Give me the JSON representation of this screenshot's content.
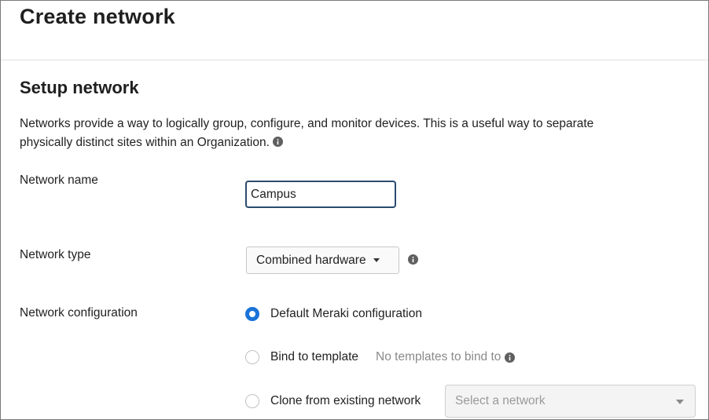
{
  "page": {
    "title": "Create network"
  },
  "setup": {
    "heading": "Setup network",
    "description": "Networks provide a way to logically group, configure, and monitor devices. This is a useful way to separate physically distinct sites within an Organization."
  },
  "fields": {
    "name": {
      "label": "Network name",
      "value": "Campus"
    },
    "type": {
      "label": "Network type",
      "selected": "Combined hardware"
    },
    "configuration": {
      "label": "Network configuration",
      "options": [
        {
          "label": "Default Meraki configuration",
          "checked": true
        },
        {
          "label": "Bind to template",
          "checked": false,
          "hint": "No templates to bind to"
        },
        {
          "label": "Clone from existing network",
          "checked": false
        }
      ],
      "clone_select_placeholder": "Select a network"
    }
  },
  "colors": {
    "accent": "#1a73d9",
    "input_focus_border": "#2a4b6e",
    "hint_text": "#8a8a8a"
  },
  "icons": {
    "info": "info-icon",
    "caret": "chevron-down-icon"
  }
}
